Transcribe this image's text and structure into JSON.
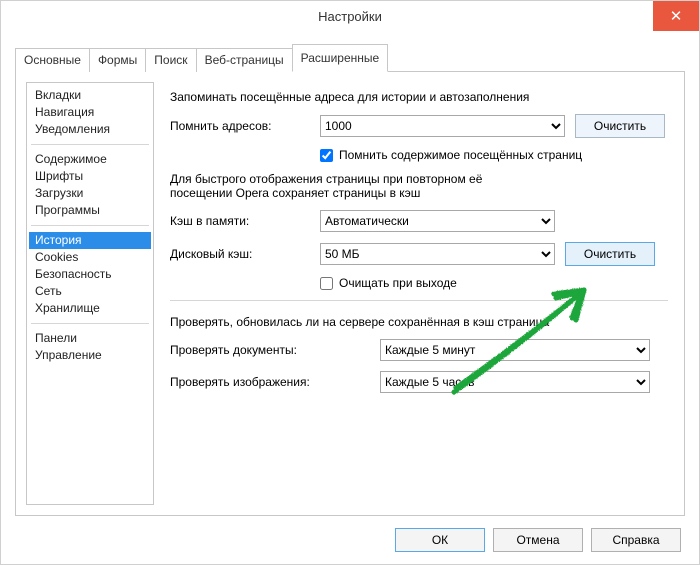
{
  "titlebar": {
    "title": "Настройки",
    "close": "✕"
  },
  "tabs": {
    "items": [
      {
        "label": "Основные"
      },
      {
        "label": "Формы"
      },
      {
        "label": "Поиск"
      },
      {
        "label": "Веб-страницы"
      },
      {
        "label": "Расширенные"
      }
    ],
    "active_index": 4
  },
  "sidebar": {
    "groups": [
      [
        "Вкладки",
        "Навигация",
        "Уведомления"
      ],
      [
        "Содержимое",
        "Шрифты",
        "Загрузки",
        "Программы"
      ],
      [
        "История",
        "Cookies",
        "Безопасность",
        "Сеть",
        "Хранилище"
      ],
      [
        "Панели",
        "Управление"
      ]
    ],
    "selected": "История"
  },
  "main": {
    "remember_heading": "Запоминать посещённые адреса для истории и автозаполнения",
    "remember_addresses_label": "Помнить адресов:",
    "remember_addresses_value": "1000",
    "clear_button": "Очистить",
    "remember_content_checkbox": "Помнить содержимое посещённых страниц",
    "remember_content_checked": true,
    "cache_text_line1": "Для быстрого отображения страницы при повторном её",
    "cache_text_line2": "посещении Opera сохраняет страницы в кэш",
    "memory_cache_label": "Кэш в памяти:",
    "memory_cache_value": "Автоматически",
    "disk_cache_label": "Дисковый кэш:",
    "disk_cache_value": "50 МБ",
    "disk_cache_clear_button": "Очистить",
    "clear_on_exit_checkbox": "Очищать при выходе",
    "clear_on_exit_checked": false,
    "revalidate_heading": "Проверять, обновилась ли на сервере сохранённая в кэш страница",
    "check_docs_label": "Проверять документы:",
    "check_docs_value": "Каждые 5 минут",
    "check_images_label": "Проверять изображения:",
    "check_images_value": "Каждые 5 часов"
  },
  "footer": {
    "ok": "ОК",
    "cancel": "Отмена",
    "help": "Справка"
  },
  "annotation": {
    "arrow_color": "#1fa63a",
    "arrow_target": "disk-cache-clear-button"
  }
}
